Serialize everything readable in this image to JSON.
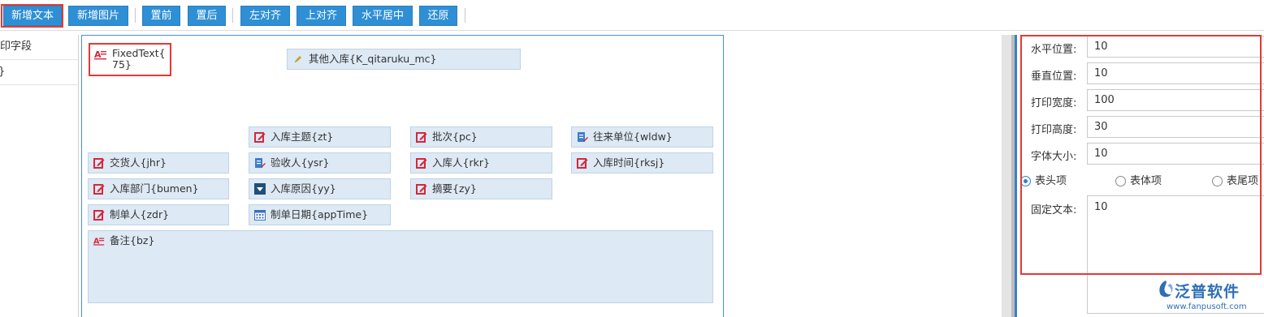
{
  "toolbar": {
    "buttons": [
      "新增文本",
      "新增图片",
      "置前",
      "置后",
      "左对齐",
      "上对齐",
      "水平居中",
      "还原"
    ]
  },
  "left_panel": {
    "rows": [
      "打印字段",
      "}"
    ]
  },
  "canvas": {
    "fixed_text": "FixedText{\n75}",
    "fields": [
      {
        "label": "其他入库{K_qitaruku_mc}",
        "icon": "pencil-icon"
      },
      {
        "label": "入库主题{zt}",
        "icon": "edit-icon"
      },
      {
        "label": "批次{pc}",
        "icon": "edit-icon"
      },
      {
        "label": "往来单位{wldw}",
        "icon": "list-edit-icon"
      },
      {
        "label": "交货人{jhr}",
        "icon": "edit-icon"
      },
      {
        "label": "验收人{ysr}",
        "icon": "list-edit-icon"
      },
      {
        "label": "入库人{rkr}",
        "icon": "edit-icon"
      },
      {
        "label": "入库时间{rksj}",
        "icon": "edit-icon"
      },
      {
        "label": "入库部门{bumen}",
        "icon": "edit-icon"
      },
      {
        "label": "入库原因{yy}",
        "icon": "dropdown-icon"
      },
      {
        "label": "摘要{zy}",
        "icon": "edit-icon"
      },
      {
        "label": "制单人{zdr}",
        "icon": "edit-icon"
      },
      {
        "label": "制单日期{appTime}",
        "icon": "calendar-icon"
      },
      {
        "label": "备注{bz}",
        "icon": "text-icon"
      }
    ]
  },
  "properties": {
    "horizontal_position_label": "水平位置:",
    "horizontal_position_value": "10",
    "vertical_position_label": "垂直位置:",
    "vertical_position_value": "10",
    "print_width_label": "打印宽度:",
    "print_width_value": "100",
    "print_height_label": "打印高度:",
    "print_height_value": "30",
    "font_size_label": "字体大小:",
    "font_size_value": "10",
    "radio_header": "表头项",
    "radio_body": "表体项",
    "radio_footer": "表尾项",
    "selected_radio": "表头项",
    "fixed_text_label": "固定文本:",
    "fixed_text_value": "10"
  },
  "watermark": {
    "name": "泛普软件",
    "url": "www.fanpusoft.com"
  },
  "colors": {
    "button_blue": "#2f8fd5",
    "field_bg": "#dde9f4",
    "highlight_red": "#e53935",
    "icon_red": "#d8263a"
  }
}
